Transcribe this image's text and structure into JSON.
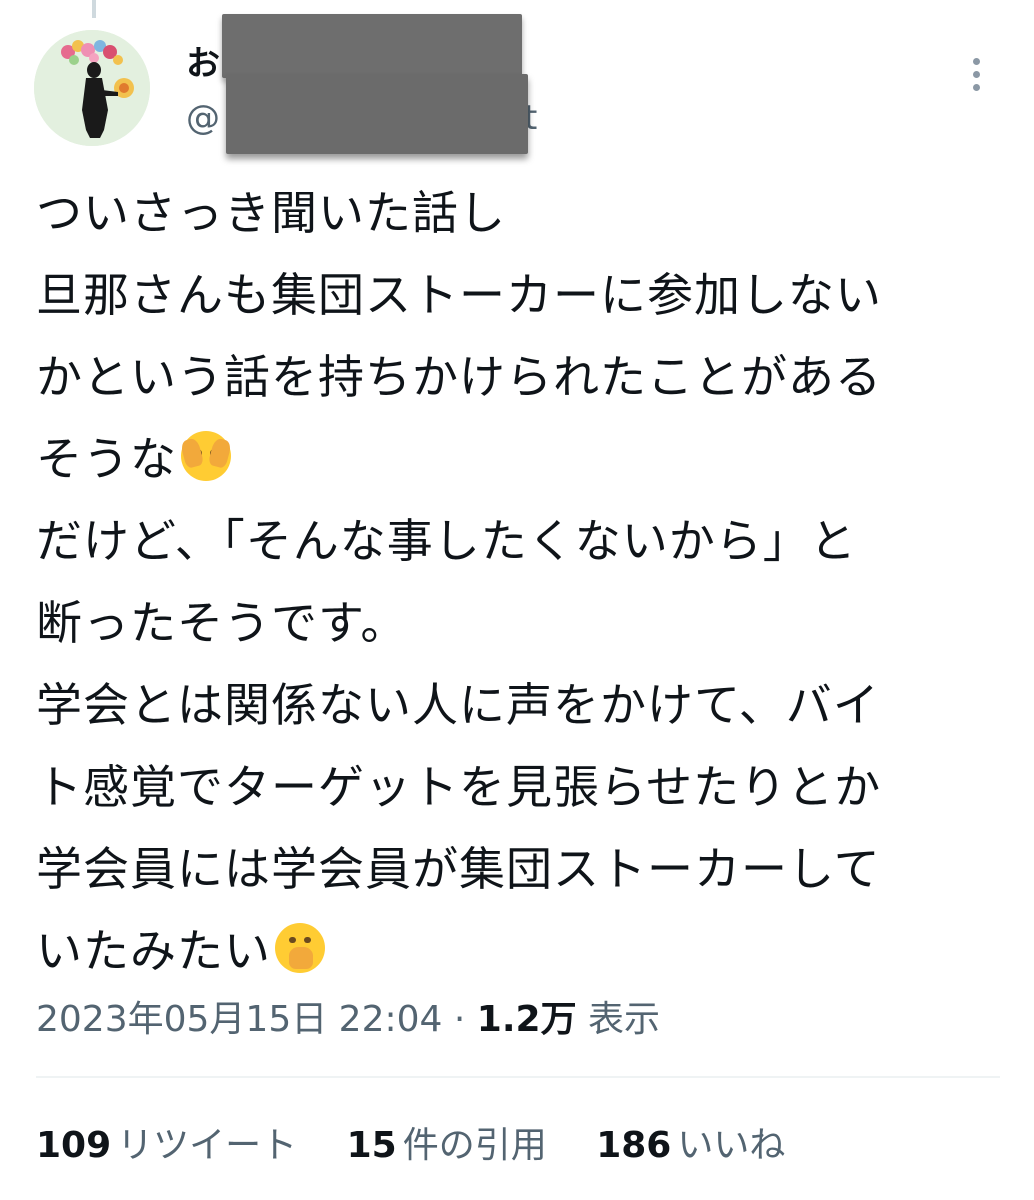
{
  "tweet": {
    "author": {
      "name_visible": "お",
      "handle_prefix": "@",
      "handle_suffix": "t"
    },
    "lines": [
      "ついさっき聞いた話し",
      "旦那さんも集団ストーカーに参加しない",
      "かという話を持ちかけられたことがある",
      "そうな",
      "だけど、「そんな事したくないから」と",
      "断ったそうです。",
      "学会とは関係ない人に声をかけて、バイ",
      "ト感覚でターゲットを見張らせたりとか",
      "学会員には学会員が集団ストーカーして",
      "いたみたい"
    ],
    "emojis": {
      "line4": "face-with-open-eyes-and-hand-over-mouth-emoji",
      "line10": "face-with-hand-over-mouth-emoji"
    },
    "timestamp": "2023年05月15日 22:04",
    "separator": "·",
    "views_count": "1.2万",
    "views_label": "表示"
  },
  "stats": {
    "retweets": {
      "count": "109",
      "label": "リツイート"
    },
    "quotes": {
      "count": "15",
      "label": "件の引用"
    },
    "likes": {
      "count": "186",
      "label": "いいね"
    }
  },
  "colors": {
    "text": "#0f1419",
    "secondary": "#536471",
    "redaction": "#6e6e6e",
    "divider": "#eff3f4"
  }
}
